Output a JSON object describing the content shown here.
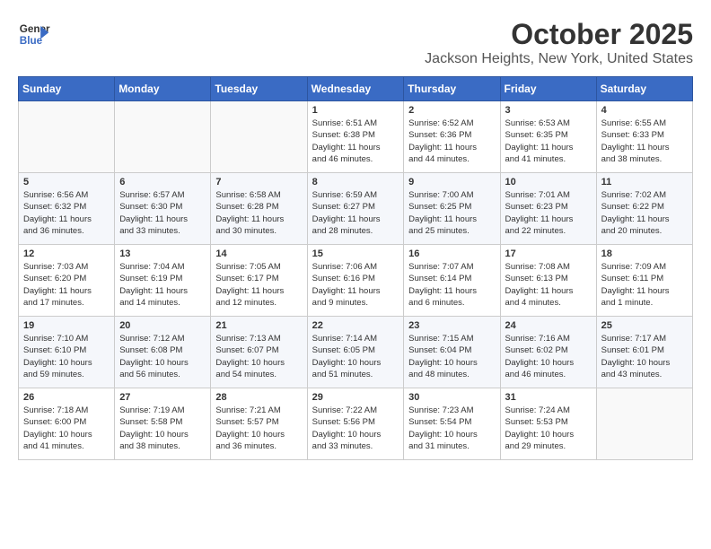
{
  "header": {
    "logo_line1": "General",
    "logo_line2": "Blue",
    "month": "October 2025",
    "location": "Jackson Heights, New York, United States"
  },
  "weekdays": [
    "Sunday",
    "Monday",
    "Tuesday",
    "Wednesday",
    "Thursday",
    "Friday",
    "Saturday"
  ],
  "weeks": [
    [
      {
        "day": "",
        "info": ""
      },
      {
        "day": "",
        "info": ""
      },
      {
        "day": "",
        "info": ""
      },
      {
        "day": "1",
        "info": "Sunrise: 6:51 AM\nSunset: 6:38 PM\nDaylight: 11 hours\nand 46 minutes."
      },
      {
        "day": "2",
        "info": "Sunrise: 6:52 AM\nSunset: 6:36 PM\nDaylight: 11 hours\nand 44 minutes."
      },
      {
        "day": "3",
        "info": "Sunrise: 6:53 AM\nSunset: 6:35 PM\nDaylight: 11 hours\nand 41 minutes."
      },
      {
        "day": "4",
        "info": "Sunrise: 6:55 AM\nSunset: 6:33 PM\nDaylight: 11 hours\nand 38 minutes."
      }
    ],
    [
      {
        "day": "5",
        "info": "Sunrise: 6:56 AM\nSunset: 6:32 PM\nDaylight: 11 hours\nand 36 minutes."
      },
      {
        "day": "6",
        "info": "Sunrise: 6:57 AM\nSunset: 6:30 PM\nDaylight: 11 hours\nand 33 minutes."
      },
      {
        "day": "7",
        "info": "Sunrise: 6:58 AM\nSunset: 6:28 PM\nDaylight: 11 hours\nand 30 minutes."
      },
      {
        "day": "8",
        "info": "Sunrise: 6:59 AM\nSunset: 6:27 PM\nDaylight: 11 hours\nand 28 minutes."
      },
      {
        "day": "9",
        "info": "Sunrise: 7:00 AM\nSunset: 6:25 PM\nDaylight: 11 hours\nand 25 minutes."
      },
      {
        "day": "10",
        "info": "Sunrise: 7:01 AM\nSunset: 6:23 PM\nDaylight: 11 hours\nand 22 minutes."
      },
      {
        "day": "11",
        "info": "Sunrise: 7:02 AM\nSunset: 6:22 PM\nDaylight: 11 hours\nand 20 minutes."
      }
    ],
    [
      {
        "day": "12",
        "info": "Sunrise: 7:03 AM\nSunset: 6:20 PM\nDaylight: 11 hours\nand 17 minutes."
      },
      {
        "day": "13",
        "info": "Sunrise: 7:04 AM\nSunset: 6:19 PM\nDaylight: 11 hours\nand 14 minutes."
      },
      {
        "day": "14",
        "info": "Sunrise: 7:05 AM\nSunset: 6:17 PM\nDaylight: 11 hours\nand 12 minutes."
      },
      {
        "day": "15",
        "info": "Sunrise: 7:06 AM\nSunset: 6:16 PM\nDaylight: 11 hours\nand 9 minutes."
      },
      {
        "day": "16",
        "info": "Sunrise: 7:07 AM\nSunset: 6:14 PM\nDaylight: 11 hours\nand 6 minutes."
      },
      {
        "day": "17",
        "info": "Sunrise: 7:08 AM\nSunset: 6:13 PM\nDaylight: 11 hours\nand 4 minutes."
      },
      {
        "day": "18",
        "info": "Sunrise: 7:09 AM\nSunset: 6:11 PM\nDaylight: 11 hours\nand 1 minute."
      }
    ],
    [
      {
        "day": "19",
        "info": "Sunrise: 7:10 AM\nSunset: 6:10 PM\nDaylight: 10 hours\nand 59 minutes."
      },
      {
        "day": "20",
        "info": "Sunrise: 7:12 AM\nSunset: 6:08 PM\nDaylight: 10 hours\nand 56 minutes."
      },
      {
        "day": "21",
        "info": "Sunrise: 7:13 AM\nSunset: 6:07 PM\nDaylight: 10 hours\nand 54 minutes."
      },
      {
        "day": "22",
        "info": "Sunrise: 7:14 AM\nSunset: 6:05 PM\nDaylight: 10 hours\nand 51 minutes."
      },
      {
        "day": "23",
        "info": "Sunrise: 7:15 AM\nSunset: 6:04 PM\nDaylight: 10 hours\nand 48 minutes."
      },
      {
        "day": "24",
        "info": "Sunrise: 7:16 AM\nSunset: 6:02 PM\nDaylight: 10 hours\nand 46 minutes."
      },
      {
        "day": "25",
        "info": "Sunrise: 7:17 AM\nSunset: 6:01 PM\nDaylight: 10 hours\nand 43 minutes."
      }
    ],
    [
      {
        "day": "26",
        "info": "Sunrise: 7:18 AM\nSunset: 6:00 PM\nDaylight: 10 hours\nand 41 minutes."
      },
      {
        "day": "27",
        "info": "Sunrise: 7:19 AM\nSunset: 5:58 PM\nDaylight: 10 hours\nand 38 minutes."
      },
      {
        "day": "28",
        "info": "Sunrise: 7:21 AM\nSunset: 5:57 PM\nDaylight: 10 hours\nand 36 minutes."
      },
      {
        "day": "29",
        "info": "Sunrise: 7:22 AM\nSunset: 5:56 PM\nDaylight: 10 hours\nand 33 minutes."
      },
      {
        "day": "30",
        "info": "Sunrise: 7:23 AM\nSunset: 5:54 PM\nDaylight: 10 hours\nand 31 minutes."
      },
      {
        "day": "31",
        "info": "Sunrise: 7:24 AM\nSunset: 5:53 PM\nDaylight: 10 hours\nand 29 minutes."
      },
      {
        "day": "",
        "info": ""
      }
    ]
  ]
}
